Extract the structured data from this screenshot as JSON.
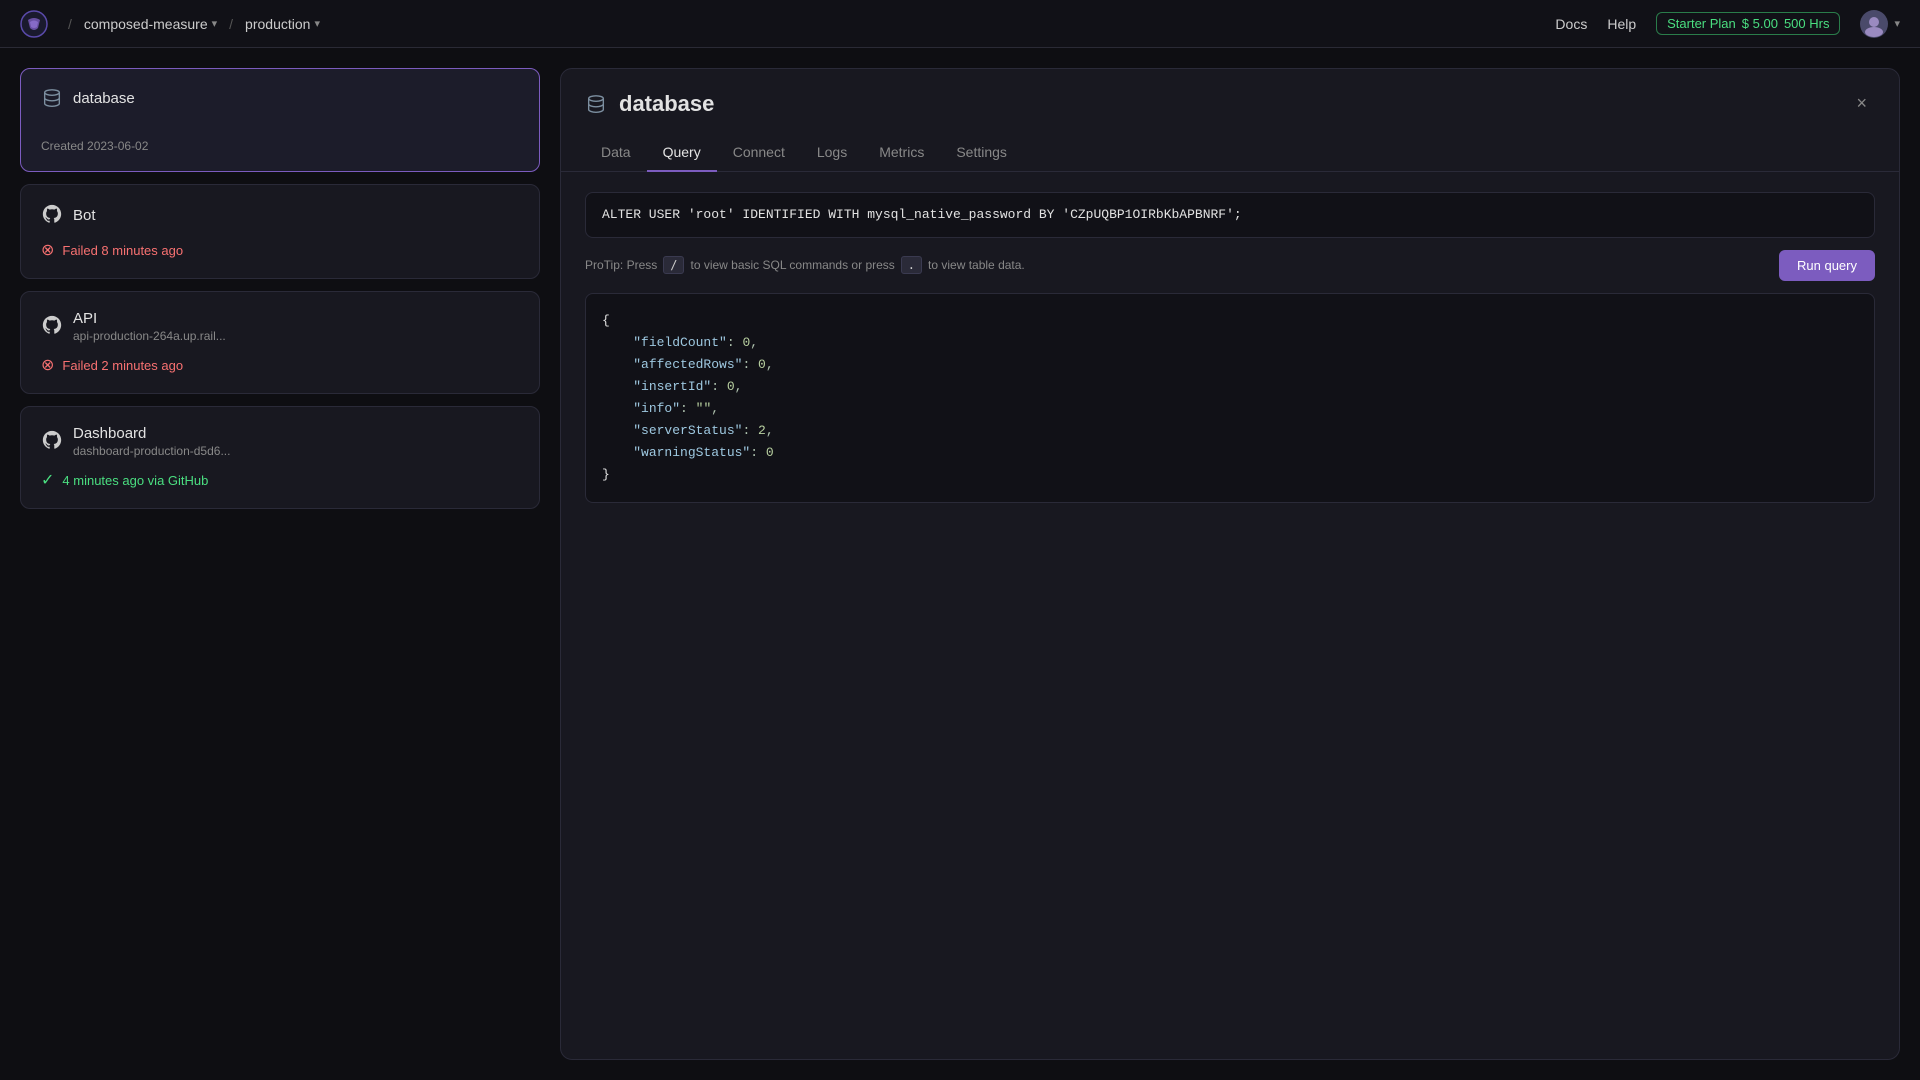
{
  "topnav": {
    "logo_alt": "Railway logo",
    "breadcrumb": [
      {
        "label": "composed-measure",
        "has_chevron": true
      },
      {
        "label": "production",
        "has_chevron": true
      }
    ],
    "docs_label": "Docs",
    "help_label": "Help",
    "plan": {
      "name": "Starter Plan",
      "price": "$ 5.00",
      "hours": "500 Hrs"
    },
    "avatar_initial": ""
  },
  "left_panel": {
    "database_card": {
      "title": "database",
      "meta": "Created 2023-06-02"
    },
    "service_cards": [
      {
        "id": "bot",
        "title": "Bot",
        "subtitle": "",
        "status_type": "failed",
        "status_text": "Failed 8 minutes ago"
      },
      {
        "id": "api",
        "title": "API",
        "subtitle": "api-production-264a.up.rail...",
        "status_type": "failed",
        "status_text": "Failed 2 minutes ago"
      },
      {
        "id": "dashboard",
        "title": "Dashboard",
        "subtitle": "dashboard-production-d5d6...",
        "status_type": "success",
        "status_text": "4 minutes ago via GitHub"
      }
    ]
  },
  "db_modal": {
    "title": "database",
    "close_label": "×",
    "tabs": [
      {
        "id": "data",
        "label": "Data"
      },
      {
        "id": "query",
        "label": "Query",
        "active": true
      },
      {
        "id": "connect",
        "label": "Connect"
      },
      {
        "id": "logs",
        "label": "Logs"
      },
      {
        "id": "metrics",
        "label": "Metrics"
      },
      {
        "id": "settings",
        "label": "Settings"
      }
    ],
    "query": {
      "input_value": "ALTER USER 'root' IDENTIFIED WITH mysql_native_password BY 'CZpUQBP1OIRbKbAPBNRF';",
      "protip_prefix": "ProTip: Press",
      "protip_key1": "/",
      "protip_mid": "to view basic SQL commands or press",
      "protip_key2": ".",
      "protip_suffix": "to view table data.",
      "run_button_label": "Run query"
    },
    "result": {
      "lines": [
        {
          "text": "{"
        },
        {
          "key": "fieldCount",
          "value": "0"
        },
        {
          "key": "affectedRows",
          "value": "0"
        },
        {
          "key": "insertId",
          "value": "0"
        },
        {
          "key": "info",
          "value": "\"\""
        },
        {
          "key": "serverStatus",
          "value": "2"
        },
        {
          "key": "warningStatus",
          "value": "0"
        },
        {
          "text": "}"
        }
      ]
    }
  }
}
